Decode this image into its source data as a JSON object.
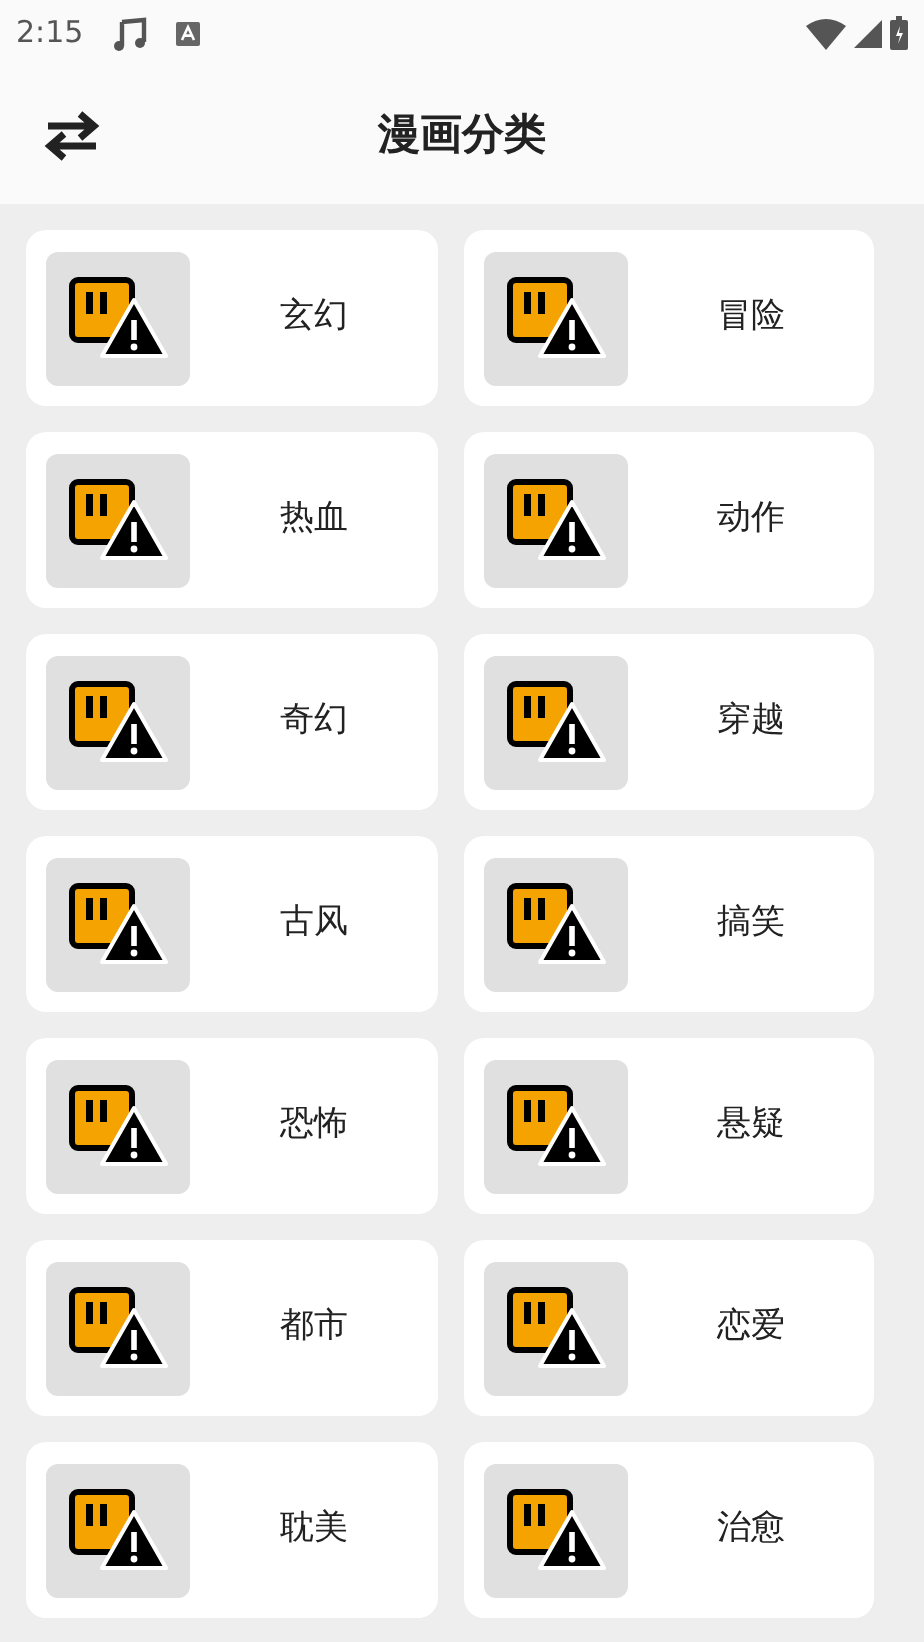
{
  "status_bar": {
    "time": "2:15"
  },
  "header": {
    "title": "漫画分类"
  },
  "categories": [
    {
      "name": "玄幻"
    },
    {
      "name": "冒险"
    },
    {
      "name": "热血"
    },
    {
      "name": "动作"
    },
    {
      "name": "奇幻"
    },
    {
      "name": "穿越"
    },
    {
      "name": "古风"
    },
    {
      "name": "搞笑"
    },
    {
      "name": "恐怖"
    },
    {
      "name": "悬疑"
    },
    {
      "name": "都市"
    },
    {
      "name": "恋爱"
    },
    {
      "name": "耽美"
    },
    {
      "name": "治愈"
    }
  ]
}
